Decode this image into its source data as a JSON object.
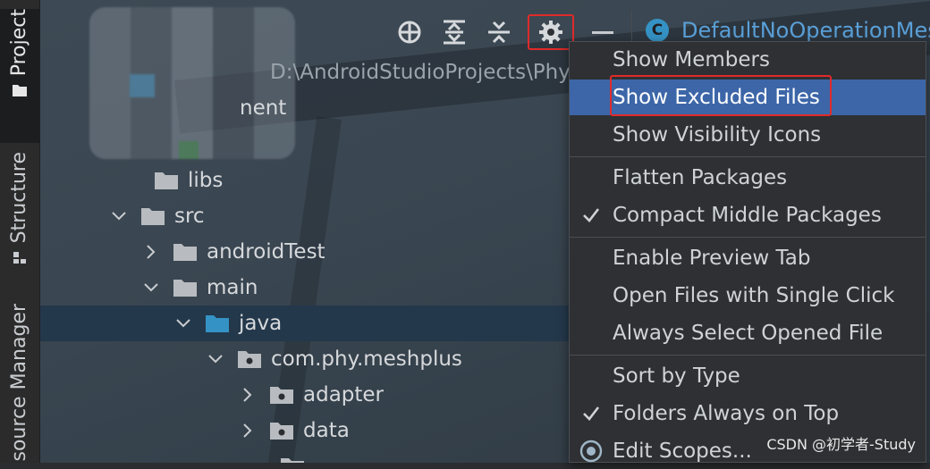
{
  "sidebar": {
    "tabs": [
      {
        "label": "Project"
      },
      {
        "label": "Structure"
      },
      {
        "label": "source Manager"
      }
    ]
  },
  "toolbar": {
    "icons": [
      "locate-icon",
      "expand-all-icon",
      "collapse-all-icon",
      "gear-icon",
      "hide-icon"
    ]
  },
  "editor_tab": {
    "icon_letter": "C",
    "title": "DefaultNoOperationMes"
  },
  "project": {
    "path": "D:\\AndroidStudioProjects\\Phy",
    "module_suffix": "nent"
  },
  "tree": [
    {
      "label": "libs",
      "expanded": null
    },
    {
      "label": "src",
      "expanded": true
    },
    {
      "label": "androidTest",
      "expanded": false
    },
    {
      "label": "main",
      "expanded": true
    },
    {
      "label": "java",
      "expanded": true,
      "selected": true
    },
    {
      "label": "com.phy.meshplus",
      "expanded": true
    },
    {
      "label": "adapter",
      "expanded": false
    },
    {
      "label": "data",
      "expanded": false
    }
  ],
  "menu": {
    "groups": [
      [
        {
          "label": "Show Members",
          "checked": false
        },
        {
          "label": "Show Excluded Files",
          "checked": false,
          "highlighted": true
        },
        {
          "label": "Show Visibility Icons",
          "checked": false
        }
      ],
      [
        {
          "label": "Flatten Packages",
          "checked": false
        },
        {
          "label": "Compact Middle Packages",
          "checked": true
        }
      ],
      [
        {
          "label": "Enable Preview Tab",
          "checked": false
        },
        {
          "label": "Open Files with Single Click",
          "checked": false
        },
        {
          "label": "Always Select Opened File",
          "checked": false
        }
      ],
      [
        {
          "label": "Sort by Type",
          "checked": false
        },
        {
          "label": "Folders Always on Top",
          "checked": true
        },
        {
          "label": "Edit Scopes...",
          "checked": false,
          "icon": "scope-icon"
        }
      ]
    ]
  },
  "watermark": "CSDN @初学者-Study",
  "colors": {
    "selection": "#24384b",
    "menu_highlight": "#3c66a8",
    "annotation_red": "#e02a2a",
    "folder_blue": "#3592c4"
  }
}
